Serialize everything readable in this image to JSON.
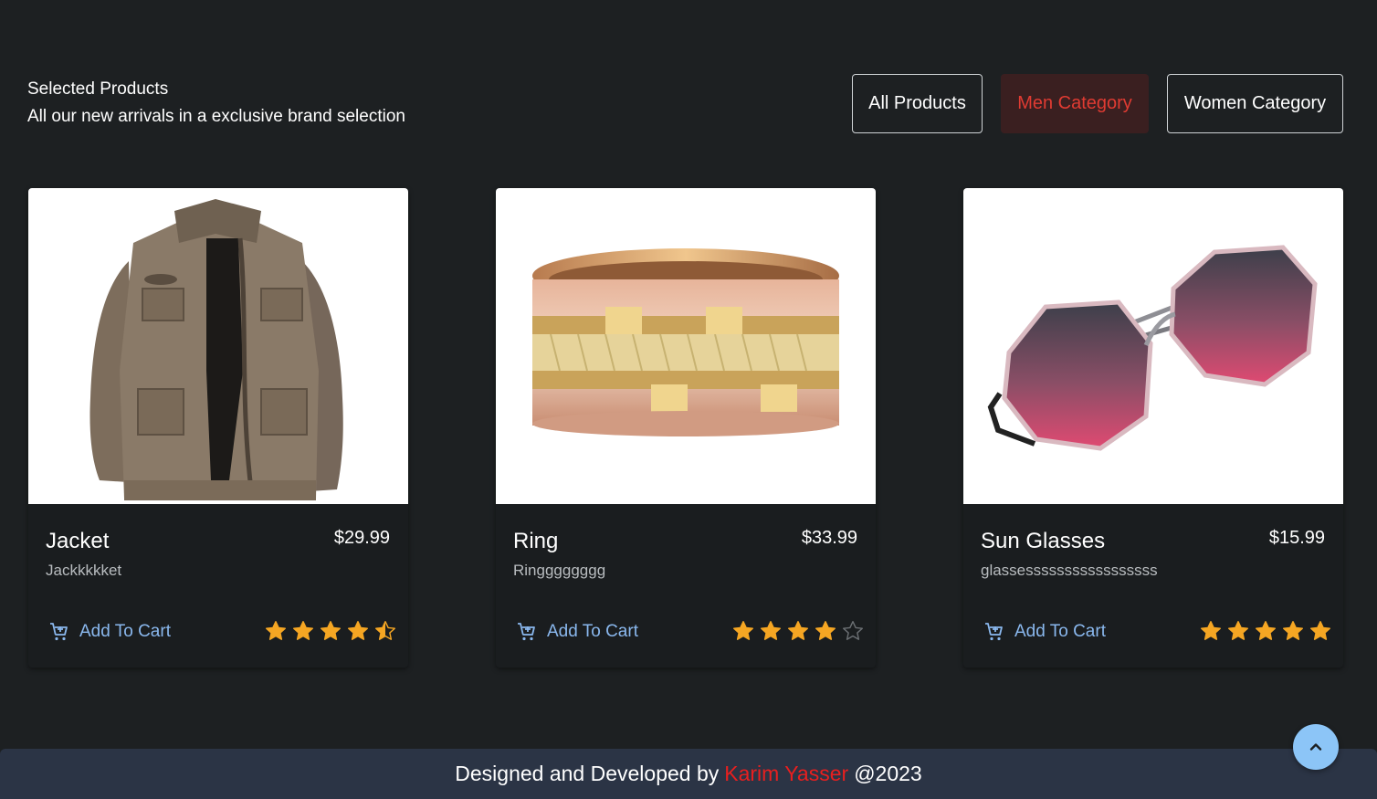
{
  "header": {
    "title": "Selected Products",
    "subtitle": "All our new arrivals in a exclusive brand selection"
  },
  "filters": {
    "all": "All Products",
    "men": "Men Category",
    "women": "Women Category",
    "active": "men"
  },
  "products": [
    {
      "name": "Jacket",
      "price": "$29.99",
      "description": "Jackkkkket",
      "cart_label": "Add To Cart",
      "rating": 4.5,
      "image": "jacket-image"
    },
    {
      "name": "Ring",
      "price": "$33.99",
      "description": "Ringggggggg",
      "cart_label": "Add To Cart",
      "rating": 4,
      "image": "ring-image"
    },
    {
      "name": "Sun Glasses",
      "price": "$15.99",
      "description": "glassesssssssssssssssss",
      "cart_label": "Add To Cart",
      "rating": 5,
      "image": "sunglasses-image"
    }
  ],
  "footer": {
    "prefix": "Designed and Developed by",
    "author": "Karim Yasser",
    "suffix": "@2023"
  },
  "colors": {
    "background": "#1d2022",
    "accent_red": "#e03b32",
    "link_blue": "#8ab8ee",
    "star_gold": "#f5a623",
    "footer_bg": "#2b3445",
    "scroll_top_bg": "#8cc5f7"
  },
  "icons": {
    "cart": "cart-plus-icon",
    "star": "star-icon",
    "scroll_top": "chevron-up-icon"
  }
}
